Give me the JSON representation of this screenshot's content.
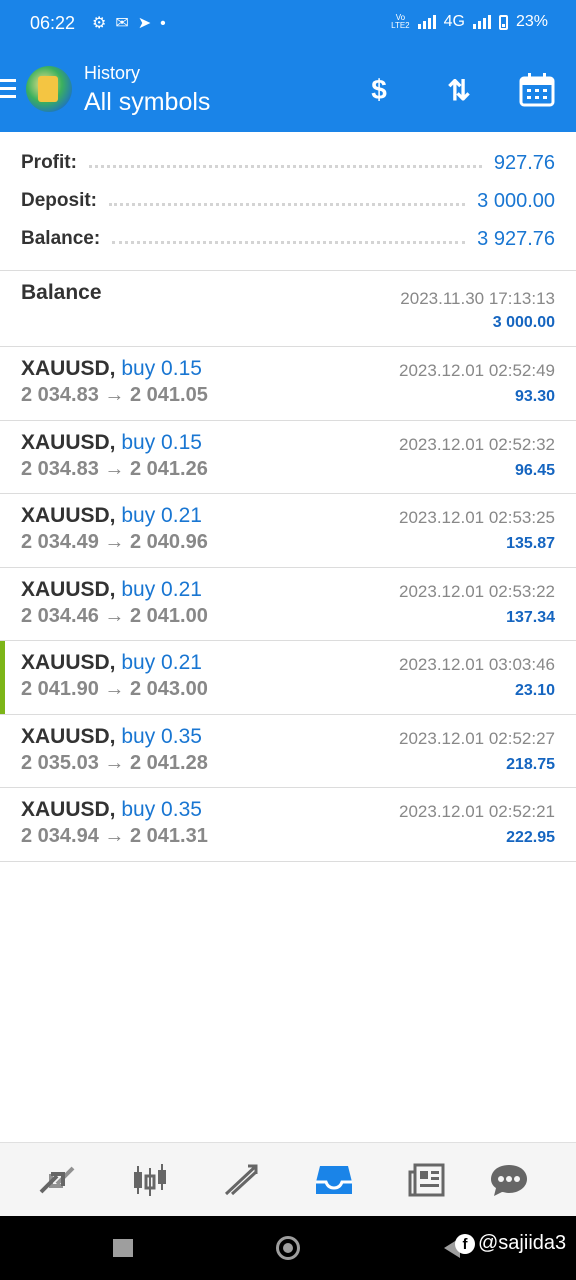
{
  "status_bar": {
    "time": "06:22",
    "network": "4G",
    "battery": "23%",
    "volte": "Vo LTE2"
  },
  "header": {
    "subtitle": "History",
    "title": "All symbols",
    "accent_color": "#1a84e8",
    "actions": [
      "currency-exchange-icon",
      "sort-icon",
      "calendar-icon"
    ]
  },
  "summary": {
    "profit_label": "Profit:",
    "profit": "927.76",
    "deposit_label": "Deposit:",
    "deposit": "3 000.00",
    "balance_label": "Balance:",
    "balance": "3 927.76"
  },
  "balance_entry": {
    "label": "Balance",
    "date": "2023.11.30 17:13:13",
    "amount": "3 000.00"
  },
  "deals": [
    {
      "symbol": "XAUUSD,",
      "side": "buy 0.15",
      "open": "2 034.83",
      "close": "2 041.05",
      "date": "2023.12.01 02:52:49",
      "profit": "93.30"
    },
    {
      "symbol": "XAUUSD,",
      "side": "buy 0.15",
      "open": "2 034.83",
      "close": "2 041.26",
      "date": "2023.12.01 02:52:32",
      "profit": "96.45"
    },
    {
      "symbol": "XAUUSD,",
      "side": "buy 0.21",
      "open": "2 034.49",
      "close": "2 040.96",
      "date": "2023.12.01 02:53:25",
      "profit": "135.87"
    },
    {
      "symbol": "XAUUSD,",
      "side": "buy 0.21",
      "open": "2 034.46",
      "close": "2 041.00",
      "date": "2023.12.01 02:53:22",
      "profit": "137.34"
    },
    {
      "symbol": "XAUUSD,",
      "side": "buy 0.21",
      "open": "2 041.90",
      "close": "2 043.00",
      "date": "2023.12.01 03:03:46",
      "profit": "23.10"
    },
    {
      "symbol": "XAUUSD,",
      "side": "buy 0.35",
      "open": "2 035.03",
      "close": "2 041.28",
      "date": "2023.12.01 02:52:27",
      "profit": "218.75"
    },
    {
      "symbol": "XAUUSD,",
      "side": "buy 0.35",
      "open": "2 034.94",
      "close": "2 041.31",
      "date": "2023.12.01 02:52:21",
      "profit": "222.95"
    }
  ],
  "arrow": "→",
  "bottom_nav": [
    "quotes-icon",
    "chart-icon",
    "trade-icon",
    "history-icon",
    "news-icon",
    "chat-icon"
  ],
  "bottom_nav_active": "history-icon",
  "watermark": "@sajiida3"
}
